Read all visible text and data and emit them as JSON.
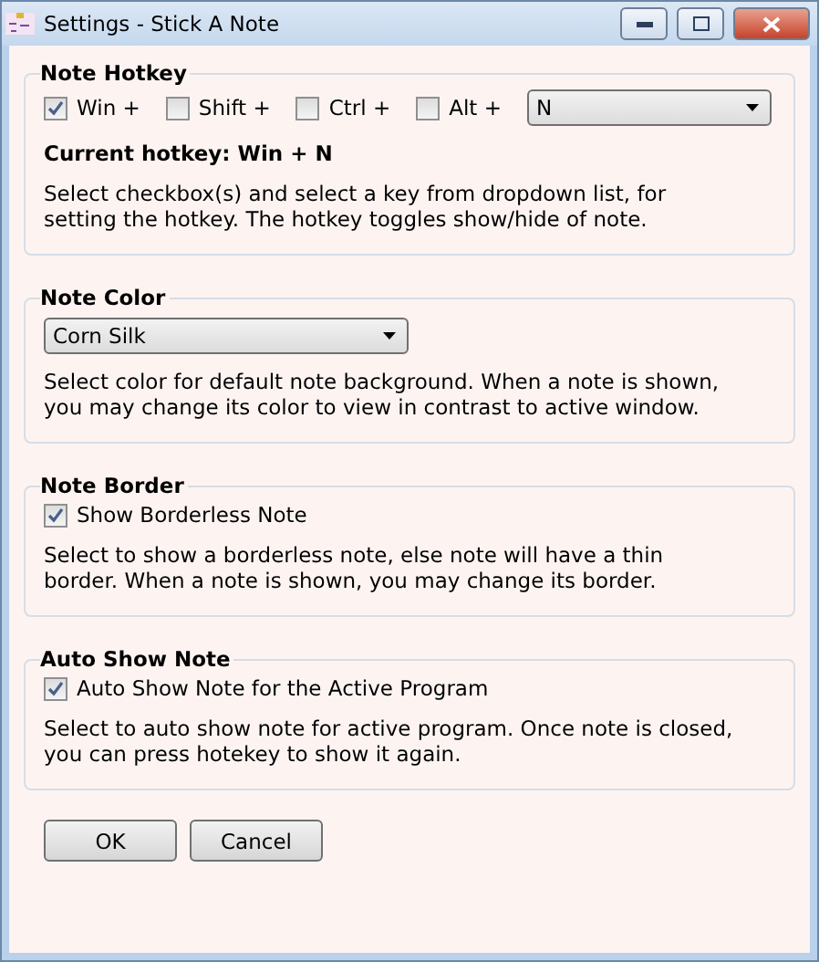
{
  "window": {
    "title": "Settings - Stick A Note"
  },
  "sections": [
    {
      "kind": "hotkey",
      "title": "Note Hotkey",
      "modifiers": [
        {
          "label": "Win +",
          "checked": true
        },
        {
          "label": "Shift +",
          "checked": false
        },
        {
          "label": "Ctrl +",
          "checked": false
        },
        {
          "label": "Alt +",
          "checked": false
        }
      ],
      "key": "N",
      "current": "Current hotkey: Win + N",
      "description": "Select checkbox(s) and select a key from dropdown list, for\nsetting the hotkey. The hotkey toggles show/hide of note."
    },
    {
      "kind": "dropdown",
      "title": "Note Color",
      "value": "Corn Silk",
      "description": "Select color for default note background. When a note is shown,\nyou may change its color to view in contrast to active window."
    },
    {
      "kind": "checkbox",
      "title": "Note Border",
      "option": {
        "label": "Show Borderless Note",
        "checked": true
      },
      "description": "Select to show a borderless note, else note will have a thin\nborder. When a note is shown, you may change its border."
    },
    {
      "kind": "checkbox",
      "title": "Auto Show Note",
      "option": {
        "label": "Auto Show Note for the Active Program",
        "checked": true
      },
      "description": "Select to auto show note for active program. Once note is closed,\nyou can press hotekey to show it again."
    }
  ],
  "buttons": [
    "OK",
    "Cancel"
  ]
}
